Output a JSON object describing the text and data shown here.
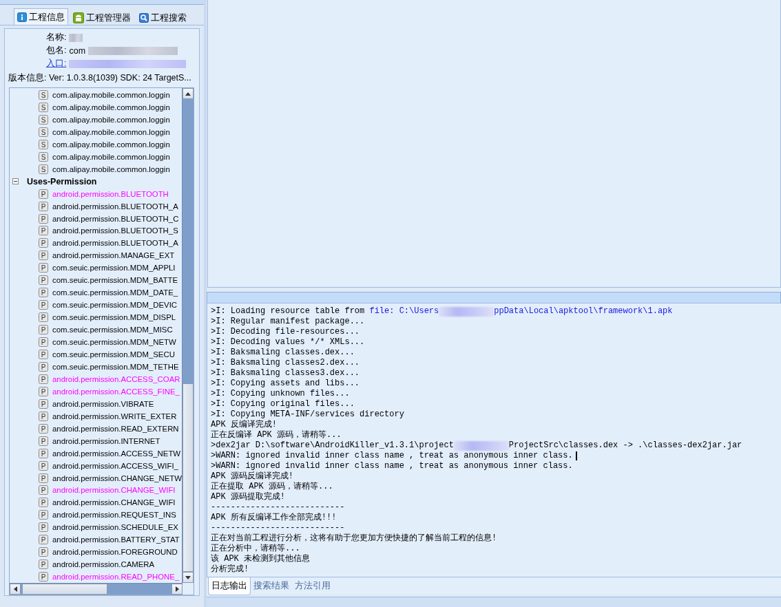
{
  "left_tabs": [
    {
      "label": "工程信息",
      "kind": "info",
      "selected": true
    },
    {
      "label": "工程管理器",
      "kind": "android",
      "selected": false
    },
    {
      "label": "工程搜索",
      "kind": "search",
      "selected": false
    }
  ],
  "info": {
    "fields": [
      {
        "label": "名称:",
        "redacted": true,
        "kind": "plain"
      },
      {
        "label": "包名:",
        "value": "com",
        "redacted": true,
        "kind": "plain"
      },
      {
        "label": "入口:",
        "redacted": true,
        "kind": "link"
      }
    ],
    "version": "版本信息: Ver: 1.0.3.8(1039) SDK: 24 TargetS..."
  },
  "tree": {
    "items": [
      {
        "text": "com.alipay.mobile.common.loggin",
        "icon": "S",
        "highlighted": false
      },
      {
        "text": "com.alipay.mobile.common.loggin",
        "icon": "S",
        "highlighted": false
      },
      {
        "text": "com.alipay.mobile.common.loggin",
        "icon": "S",
        "highlighted": false
      },
      {
        "text": "com.alipay.mobile.common.loggin",
        "icon": "S",
        "highlighted": false
      },
      {
        "text": "com.alipay.mobile.common.loggin",
        "icon": "S",
        "highlighted": false
      },
      {
        "text": "com.alipay.mobile.common.loggin",
        "icon": "S",
        "highlighted": false
      },
      {
        "text": "com.alipay.mobile.common.loggin",
        "icon": "S",
        "highlighted": false
      }
    ],
    "groups": [
      {
        "label": "Uses-Permission",
        "expanded": true,
        "children": [
          {
            "text": "android.permission.BLUETOOTH",
            "icon": "P",
            "highlighted": true
          },
          {
            "text": "android.permission.BLUETOOTH_A",
            "icon": "P",
            "highlighted": false
          },
          {
            "text": "android.permission.BLUETOOTH_C",
            "icon": "P",
            "highlighted": false
          },
          {
            "text": "android.permission.BLUETOOTH_S",
            "icon": "P",
            "highlighted": false
          },
          {
            "text": "android.permission.BLUETOOTH_A",
            "icon": "P",
            "highlighted": false
          },
          {
            "text": "android.permission.MANAGE_EXT",
            "icon": "P",
            "highlighted": false
          },
          {
            "text": "com.seuic.permission.MDM_APPLI",
            "icon": "P",
            "highlighted": false
          },
          {
            "text": "com.seuic.permission.MDM_BATTE",
            "icon": "P",
            "highlighted": false
          },
          {
            "text": "com.seuic.permission.MDM_DATE_",
            "icon": "P",
            "highlighted": false
          },
          {
            "text": "com.seuic.permission.MDM_DEVIC",
            "icon": "P",
            "highlighted": false
          },
          {
            "text": "com.seuic.permission.MDM_DISPL",
            "icon": "P",
            "highlighted": false
          },
          {
            "text": "com.seuic.permission.MDM_MISC",
            "icon": "P",
            "highlighted": false
          },
          {
            "text": "com.seuic.permission.MDM_NETW",
            "icon": "P",
            "highlighted": false
          },
          {
            "text": "com.seuic.permission.MDM_SECU",
            "icon": "P",
            "highlighted": false
          },
          {
            "text": "com.seuic.permission.MDM_TETHE",
            "icon": "P",
            "highlighted": false
          },
          {
            "text": "android.permission.ACCESS_COAR",
            "icon": "P",
            "highlighted": true
          },
          {
            "text": "android.permission.ACCESS_FINE_",
            "icon": "P",
            "highlighted": true
          },
          {
            "text": "android.permission.VIBRATE",
            "icon": "P",
            "highlighted": false
          },
          {
            "text": "android.permission.WRITE_EXTER",
            "icon": "P",
            "highlighted": false
          },
          {
            "text": "android.permission.READ_EXTERN",
            "icon": "P",
            "highlighted": false
          },
          {
            "text": "android.permission.INTERNET",
            "icon": "P",
            "highlighted": false
          },
          {
            "text": "android.permission.ACCESS_NETW",
            "icon": "P",
            "highlighted": false
          },
          {
            "text": "android.permission.ACCESS_WIFI_",
            "icon": "P",
            "highlighted": false
          },
          {
            "text": "android.permission.CHANGE_NETW",
            "icon": "P",
            "highlighted": false
          },
          {
            "text": "android.permission.CHANGE_WIFI",
            "icon": "P",
            "highlighted": true
          },
          {
            "text": "android.permission.CHANGE_WIFI",
            "icon": "P",
            "highlighted": false
          },
          {
            "text": "android.permission.REQUEST_INS",
            "icon": "P",
            "highlighted": false
          },
          {
            "text": "android.permission.SCHEDULE_EX",
            "icon": "P",
            "highlighted": false
          },
          {
            "text": "android.permission.BATTERY_STAT",
            "icon": "P",
            "highlighted": false
          },
          {
            "text": "android.permission.FOREGROUND",
            "icon": "P",
            "highlighted": false
          },
          {
            "text": "android.permission.CAMERA",
            "icon": "P",
            "highlighted": false
          },
          {
            "text": "android.permission.READ_PHONE_",
            "icon": "P",
            "highlighted": true
          }
        ]
      }
    ]
  },
  "log": {
    "lines": [
      {
        "parts": [
          {
            "kind": "plain",
            "text": ">I: Loading resource table from "
          },
          {
            "kind": "link",
            "text": "file: C:\\Users"
          },
          {
            "kind": "redacted"
          },
          {
            "kind": "link",
            "text": "ppData\\Local\\apktool\\framework\\1.apk"
          }
        ]
      },
      {
        "parts": [
          {
            "kind": "plain",
            "text": ">I: Regular manifest package..."
          }
        ]
      },
      {
        "parts": [
          {
            "kind": "plain",
            "text": ">I: Decoding file-resources..."
          }
        ]
      },
      {
        "parts": [
          {
            "kind": "plain",
            "text": ">I: Decoding values */* XMLs..."
          }
        ]
      },
      {
        "parts": [
          {
            "kind": "plain",
            "text": ">I: Baksmaling classes.dex..."
          }
        ]
      },
      {
        "parts": [
          {
            "kind": "plain",
            "text": ">I: Baksmaling classes2.dex..."
          }
        ]
      },
      {
        "parts": [
          {
            "kind": "plain",
            "text": ">I: Baksmaling classes3.dex..."
          }
        ]
      },
      {
        "parts": [
          {
            "kind": "plain",
            "text": ">I: Copying assets and libs..."
          }
        ]
      },
      {
        "parts": [
          {
            "kind": "plain",
            "text": ">I: Copying unknown files..."
          }
        ]
      },
      {
        "parts": [
          {
            "kind": "plain",
            "text": ">I: Copying original files..."
          }
        ]
      },
      {
        "parts": [
          {
            "kind": "plain",
            "text": ">I: Copying META-INF/services directory"
          }
        ]
      },
      {
        "parts": [
          {
            "kind": "plain",
            "text": "APK 反编译完成!"
          }
        ]
      },
      {
        "parts": [
          {
            "kind": "plain",
            "text": "正在反编译 APK 源码，请稍等..."
          }
        ]
      },
      {
        "parts": [
          {
            "kind": "plain",
            "text": ">dex2jar D:\\software\\AndroidKiller_v1.3.1\\project"
          },
          {
            "kind": "redacted"
          },
          {
            "kind": "plain",
            "text": "ProjectSrc\\classes.dex -> .\\classes-dex2jar.jar"
          }
        ]
      },
      {
        "parts": [
          {
            "kind": "plain",
            "text": ">WARN: ignored invalid inner class name , treat as anonymous inner class."
          },
          {
            "kind": "cursor"
          }
        ]
      },
      {
        "parts": [
          {
            "kind": "plain",
            "text": ">WARN: ignored invalid inner class name , treat as anonymous inner class."
          }
        ]
      },
      {
        "parts": [
          {
            "kind": "plain",
            "text": "APK 源码反编译完成!"
          }
        ]
      },
      {
        "parts": [
          {
            "kind": "plain",
            "text": "正在提取 APK 源码，请稍等..."
          }
        ]
      },
      {
        "parts": [
          {
            "kind": "plain",
            "text": "APK 源码提取完成!"
          }
        ]
      },
      {
        "parts": [
          {
            "kind": "plain",
            "text": "---------------------------"
          }
        ]
      },
      {
        "parts": [
          {
            "kind": "plain",
            "text": "APK 所有反编译工作全部完成!!!"
          }
        ]
      },
      {
        "parts": [
          {
            "kind": "plain",
            "text": "---------------------------"
          }
        ]
      },
      {
        "parts": [
          {
            "kind": "plain",
            "text": "正在对当前工程进行分析，这将有助于您更加方便快捷的了解当前工程的信息!"
          }
        ]
      },
      {
        "parts": [
          {
            "kind": "plain",
            "text": "正在分析中，请稍等..."
          }
        ]
      },
      {
        "parts": [
          {
            "kind": "plain",
            "text": "该 APK 未检测到其他信息"
          }
        ]
      },
      {
        "parts": [
          {
            "kind": "plain",
            "text": "分析完成!"
          }
        ]
      }
    ]
  },
  "bottom_tabs": [
    {
      "label": "日志输出",
      "selected": true
    },
    {
      "label": "搜索结果",
      "selected": false
    },
    {
      "label": "方法引用",
      "selected": false
    }
  ]
}
